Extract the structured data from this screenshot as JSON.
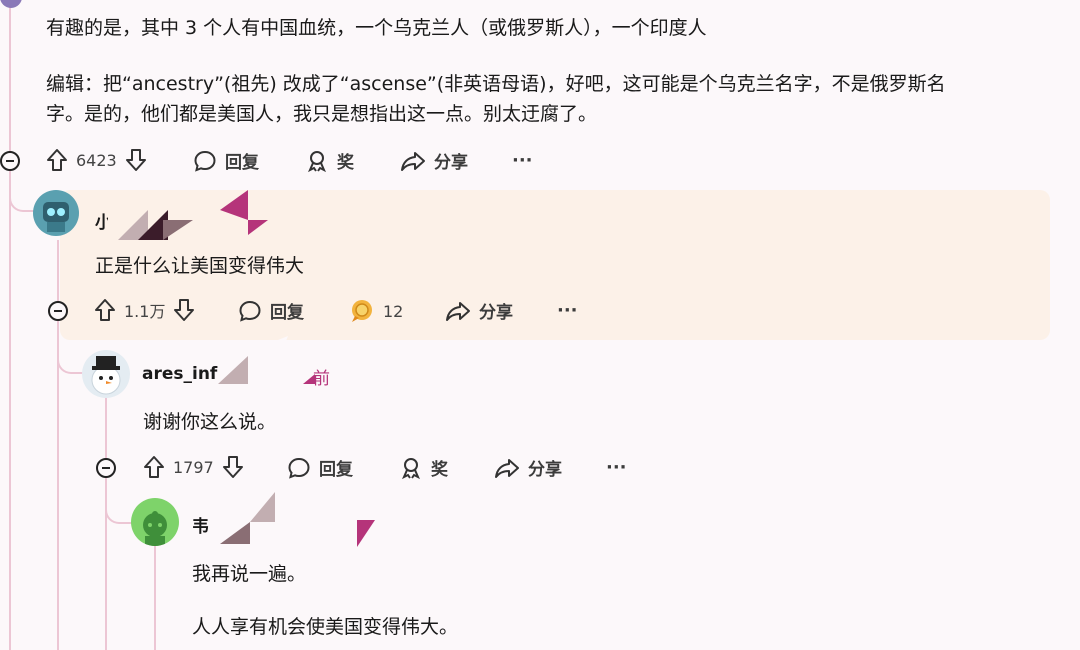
{
  "top_comment": {
    "line1": "有趣的是，其中 3 个人有中国血统，一个乌克兰人（或俄罗斯人），一个印度人",
    "edit_line1": "编辑：把“ancestry”(祖先) 改成了“ascense”(非英语母语)，好吧，这可能是个乌克兰名字，不是俄罗斯名",
    "edit_line2": "字。是的，他们都是美国人，我只是想指出这一点。别太迂腐了。",
    "actions": {
      "votes": "6423",
      "reply": "回复",
      "award": "奖",
      "share": "分享"
    }
  },
  "comment1": {
    "username_visible": "小",
    "body": "正是什么让美国变得伟大",
    "actions": {
      "votes": "1.1万",
      "reply": "回复",
      "awards": "12",
      "share": "分享"
    }
  },
  "comment2": {
    "username": "ares_inf",
    "time_suffix": "前",
    "body": "谢谢你这么说。",
    "actions": {
      "votes": "1797",
      "reply": "回复",
      "award": "奖",
      "share": "分享"
    }
  },
  "comment3": {
    "username_visible": "韦",
    "body_line1": "我再说一遍。",
    "body_line2": "人人享有机会使美国变得伟大。"
  },
  "colors": {
    "thread_line": "#ecc6d4",
    "highlight_bg": "#fcf1e8",
    "redact_pink": "#b5347a"
  }
}
